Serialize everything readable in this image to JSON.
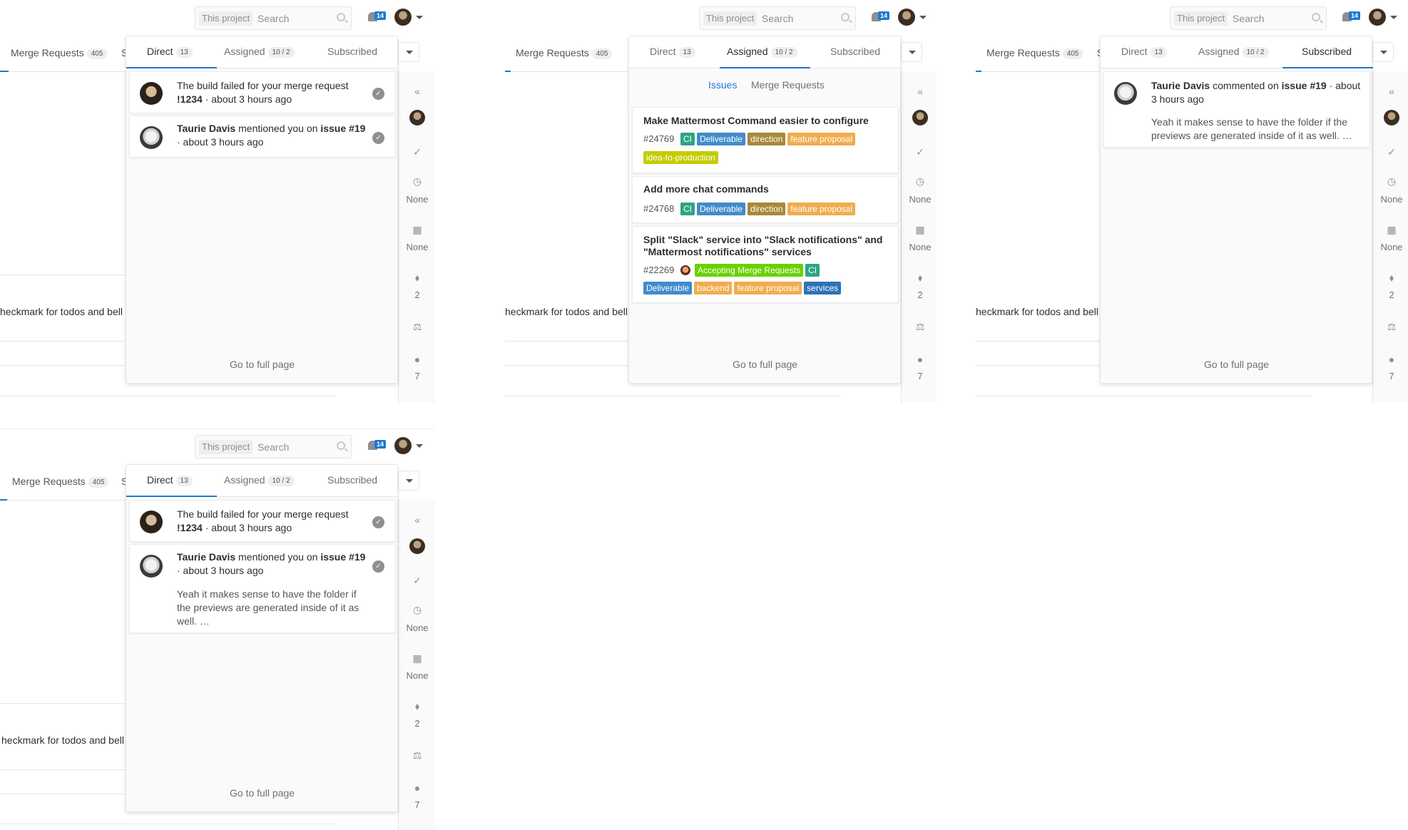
{
  "colors": {
    "accent": "#1f78d1",
    "label_ci": "#2ea486",
    "label_deliverable": "#428bca",
    "label_direction": "#a8883a",
    "label_feature_proposal": "#f0ad4e",
    "label_idea": "#c4cc00",
    "label_accepting_mr": "#69d100",
    "label_backend": "#f0ad4e",
    "label_services": "#2d72b8"
  },
  "header": {
    "search_scope": "This project",
    "search_placeholder": "Search",
    "notification_count": "14"
  },
  "background": {
    "merge_requests_label": "Merge Requests",
    "merge_requests_count": "405",
    "tab_stub": "S",
    "truncated_text": "heckmark for todos and bell"
  },
  "sidebar": {
    "none_1": "None",
    "none_2": "None",
    "labels_count": "2",
    "participants_count": "7"
  },
  "tabs": {
    "direct": "Direct",
    "direct_count": "13",
    "assigned": "Assigned",
    "assigned_count": "10 / 2",
    "subscribed": "Subscribed"
  },
  "footer": {
    "go_full": "Go to full page"
  },
  "notifications": {
    "build": {
      "prefix": "The build failed for your merge request",
      "ref": "!1234",
      "time": "· about 3 hours ago"
    },
    "mention": {
      "actor": "Taurie Davis",
      "verb": "mentioned you on",
      "obj": "issue",
      "ref": "#19",
      "time": "· about 3 hours ago"
    },
    "comment": {
      "body": "Yeah it makes sense to have the folder if the previews are generated inside of it as well. …"
    }
  },
  "subscribed": {
    "actor": "Taurie Davis",
    "verb": "commented on",
    "obj": "issue #19",
    "time": "· about",
    "time2": "3 hours ago",
    "body": "Yeah it makes sense to have the folder if the previews are generated inside of it as well. …"
  },
  "assigned_view": {
    "subtabs": {
      "issues": "Issues",
      "merge_requests": "Merge Requests"
    },
    "issues": [
      {
        "title": "Make Mattermost Command easier to configure",
        "number": "#24769",
        "labels": [
          "CI",
          "Deliverable",
          "direction",
          "feature proposal",
          "idea-to-production"
        ]
      },
      {
        "title": "Add more chat commands",
        "number": "#24768",
        "labels": [
          "CI",
          "Deliverable",
          "direction",
          "feature proposal"
        ]
      },
      {
        "title_1": "Split \"Slack\" service into \"Slack notifications\" and",
        "title_2": "\"Mattermost notifications\" services",
        "number": "#22269",
        "labels": [
          "Accepting Merge Requests",
          "CI",
          "Deliverable",
          "backend",
          "feature proposal",
          "services"
        ]
      }
    ]
  }
}
